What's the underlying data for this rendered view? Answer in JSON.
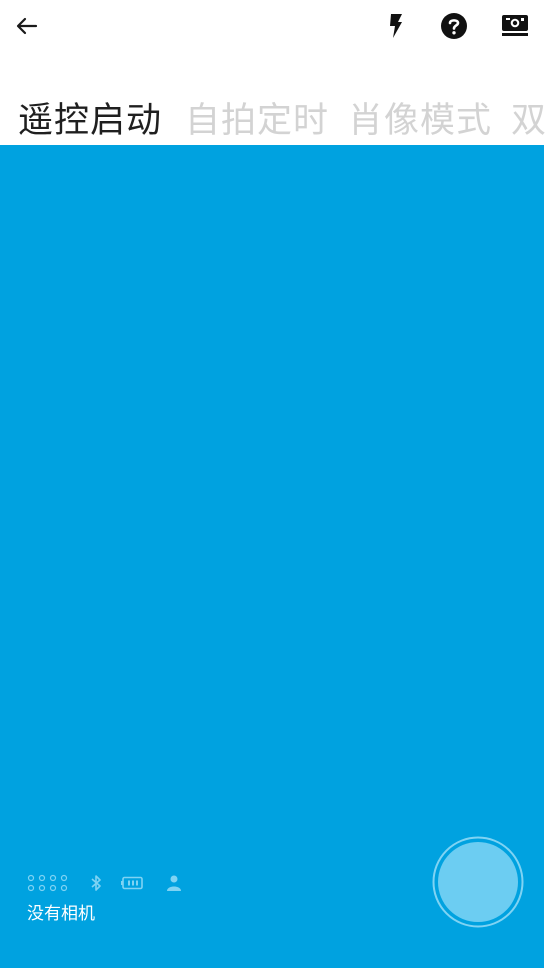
{
  "toolbar": {
    "back_icon": "arrow-left-icon",
    "flash_icon": "flash-icon",
    "help_icon": "help-circle-icon",
    "camera_icon": "camera-mode-icon"
  },
  "tabs": [
    {
      "label": "遥控启动",
      "active": true
    },
    {
      "label": "自拍定时",
      "active": false
    },
    {
      "label": "肖像模式",
      "active": false
    },
    {
      "label": "双",
      "active": false
    }
  ],
  "status": {
    "icons": [
      "dots-grid-icon",
      "bluetooth-icon",
      "battery-icon",
      "person-icon"
    ],
    "camera_text": "没有相机"
  },
  "colors": {
    "viewport_bg": "#00a2e0",
    "active_tab": "#1f1f1f",
    "inactive_tab": "#d3d3d3",
    "status_icon": "#7fd3f3",
    "shutter_fill": "#6ccdf2"
  }
}
